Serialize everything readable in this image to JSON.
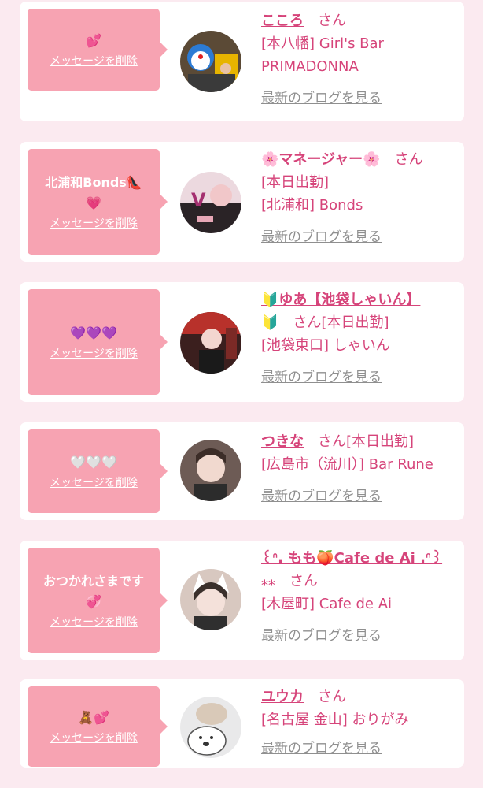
{
  "cards": [
    {
      "message": "💕",
      "delete_label": "メッセージを削除",
      "name": "こころ",
      "san": "さん",
      "lines": [
        "[本八幡] Girl's Bar",
        "PRIMADONNA"
      ],
      "blog_label": "最新のブログを見る"
    },
    {
      "message": "北浦和Bonds👠\n💗",
      "delete_label": "メッセージを削除",
      "name": "🌸マネージャー🌸",
      "san": "さん",
      "lines": [
        "[本日出勤]",
        "[北浦和] Bonds"
      ],
      "blog_label": "最新のブログを見る"
    },
    {
      "message": "💜💜💜",
      "delete_label": "メッセージを削除",
      "name": "🔰ゆあ【池袋しゃいん】",
      "name2": "🔰",
      "san": "さん",
      "lines_after_san": "[本日出勤]",
      "lines": [
        "[池袋東口] しゃいん"
      ],
      "blog_label": "最新のブログを見る"
    },
    {
      "message": "🤍🤍🤍",
      "delete_label": "メッセージを削除",
      "name": "つきな",
      "san": "さん",
      "lines_after_san": "[本日出勤]",
      "lines": [
        "[広島市（流川）] Bar Rune"
      ],
      "blog_label": "最新のブログを見る"
    },
    {
      "message": "おつかれさまです\n💞",
      "delete_label": "メッセージを削除",
      "name": "꒰ᐢ. もも🍑Cafe de Ai .ᐢ꒱",
      "name2": "⁎⁎",
      "san": "さん",
      "lines": [
        "[木屋町] Cafe de Ai"
      ],
      "blog_label": "最新のブログを見る"
    },
    {
      "message": "🧸💕",
      "delete_label": "メッセージを削除",
      "name": "ユウカ",
      "san": "さん",
      "lines": [
        "[名古屋 金山] おりがみ"
      ],
      "blog_label": "最新のブログを見る"
    }
  ],
  "colors": {
    "accent": "#d6447a",
    "bubble": "#f7a3b2",
    "background": "#fbeaf0"
  }
}
